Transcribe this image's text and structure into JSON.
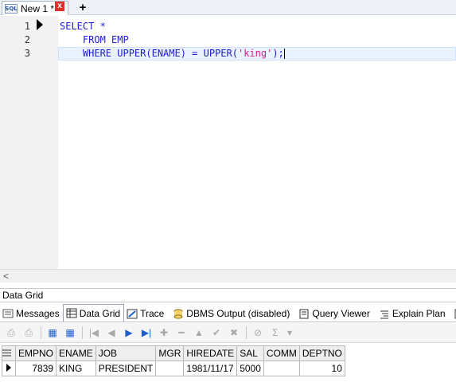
{
  "tab": {
    "icon": "sql-file-icon",
    "icon_text": "SQL",
    "label": "New 1 *",
    "close": "x",
    "new": "+"
  },
  "editor": {
    "line_numbers": [
      "1",
      "2",
      "3"
    ],
    "line1": "SELECT *",
    "line2": "    FROM EMP",
    "line3_a": "    WHERE UPPER(ENAME) = UPPER(",
    "line3_str": "'king'",
    "line3_b": ");"
  },
  "scroll_left": "<",
  "panel_title": "Data Grid",
  "result_tabs": [
    "Messages",
    "Data Grid",
    "Trace",
    "DBMS Output (disabled)",
    "Query Viewer",
    "Explain Plan",
    "S"
  ],
  "toolbar_glyphs": [
    "⎙",
    "⎙",
    "▦",
    "▦",
    "|◀",
    "◀",
    "▶",
    "▶|",
    "✚",
    "━",
    "▲",
    "✔",
    "✖",
    "⊘",
    "Σ",
    "▾"
  ],
  "grid": {
    "columns": [
      "EMPNO",
      "ENAME",
      "JOB",
      "MGR",
      "HIREDATE",
      "SAL",
      "COMM",
      "DEPTNO"
    ],
    "rows": [
      [
        "7839",
        "KING",
        "PRESIDENT",
        "",
        "1981/11/17",
        "5000",
        "",
        "10"
      ]
    ]
  },
  "colors": {
    "keyword": "#1c1cd6",
    "string": "#d0208c",
    "accent": "#1c5ec7"
  }
}
